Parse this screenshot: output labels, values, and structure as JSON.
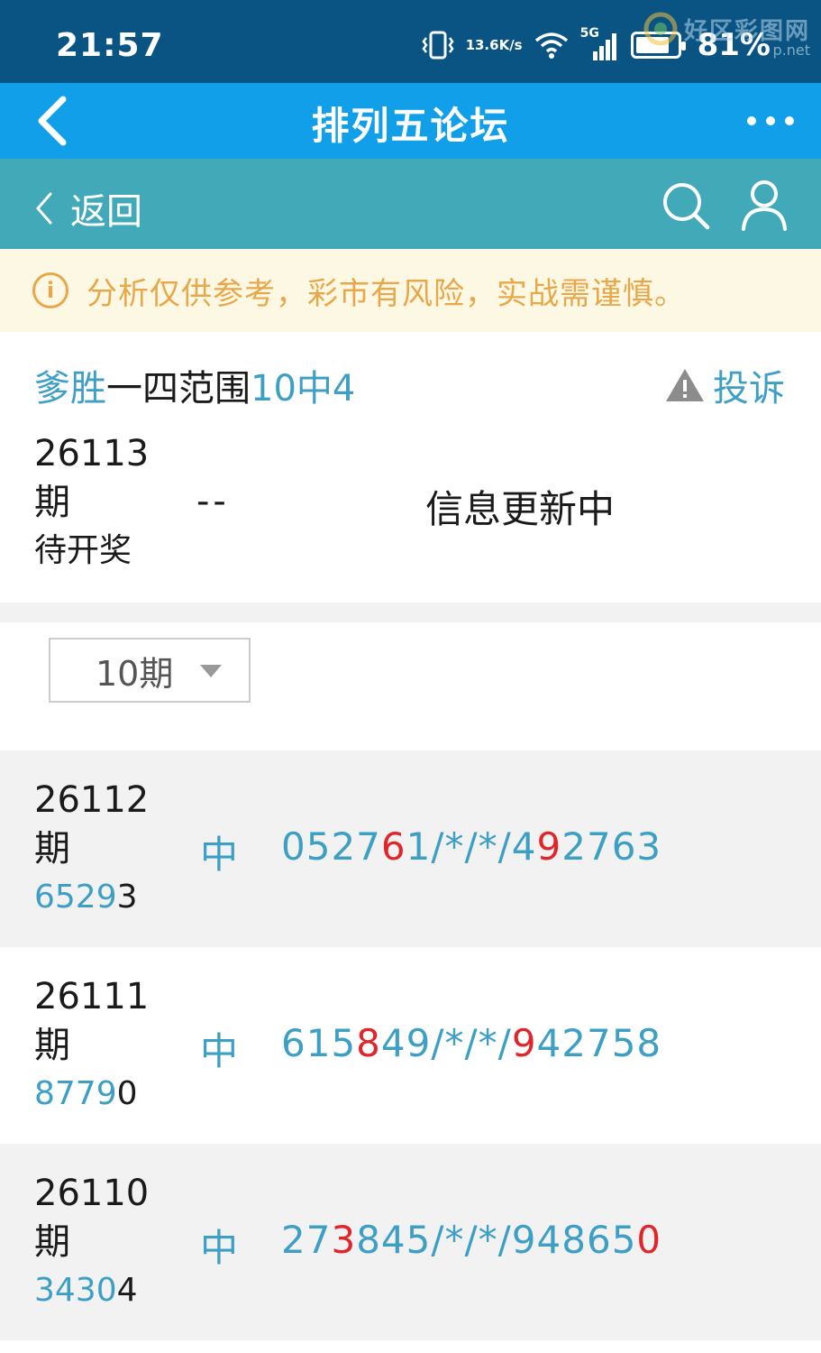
{
  "status_bar": {
    "time": "21:57",
    "speed_top": "13.6",
    "speed_bottom": "K/s",
    "network": "5G",
    "battery": "81%",
    "battery_level": 0.81,
    "watermark_name": "好区彩图网",
    "watermark_url": "p.net"
  },
  "titlebar": {
    "title": "排列五论坛"
  },
  "subnav": {
    "back_label": "返回"
  },
  "notice": {
    "text": "分析仅供参考，彩市有风险，实战需谨慎。"
  },
  "header": {
    "title_part1": "爹胜",
    "title_part2": "一四范围",
    "title_part3": "10中4",
    "report_label": "投诉",
    "issue_number": "26113",
    "issue_suffix": "期",
    "issue_state": "待开奖",
    "dash": "--",
    "status": "信息更新中"
  },
  "filter": {
    "selected": "10期"
  },
  "rows": [
    {
      "issue": "26112",
      "suffix": "期",
      "draw_hit": "6529",
      "draw_rest": "3",
      "hit_label": "中",
      "pred": [
        {
          "t": "0527",
          "red": false
        },
        {
          "t": "6",
          "red": true
        },
        {
          "t": "1/*/*/4",
          "red": false
        },
        {
          "t": "9",
          "red": true
        },
        {
          "t": "2763",
          "red": false
        }
      ]
    },
    {
      "issue": "26111",
      "suffix": "期",
      "draw_hit": "8779",
      "draw_rest": "0",
      "hit_label": "中",
      "pred": [
        {
          "t": "615",
          "red": false
        },
        {
          "t": "8",
          "red": true
        },
        {
          "t": "49/*/*/",
          "red": false
        },
        {
          "t": "9",
          "red": true
        },
        {
          "t": "42758",
          "red": false
        }
      ]
    },
    {
      "issue": "26110",
      "suffix": "期",
      "draw_hit": "3430",
      "draw_rest": "4",
      "hit_label": "中",
      "pred": [
        {
          "t": "27",
          "red": false
        },
        {
          "t": "3",
          "red": true
        },
        {
          "t": "845/*/*/94865",
          "red": false
        },
        {
          "t": "0",
          "red": true
        }
      ]
    }
  ],
  "colors": {
    "status_bar": "#0a5484",
    "titlebar": "#109fe8",
    "subnav": "#42a9b9",
    "accent_blue": "#3e9fc5",
    "highlight_red": "#e0262b",
    "notice_text": "#e8a84a"
  }
}
